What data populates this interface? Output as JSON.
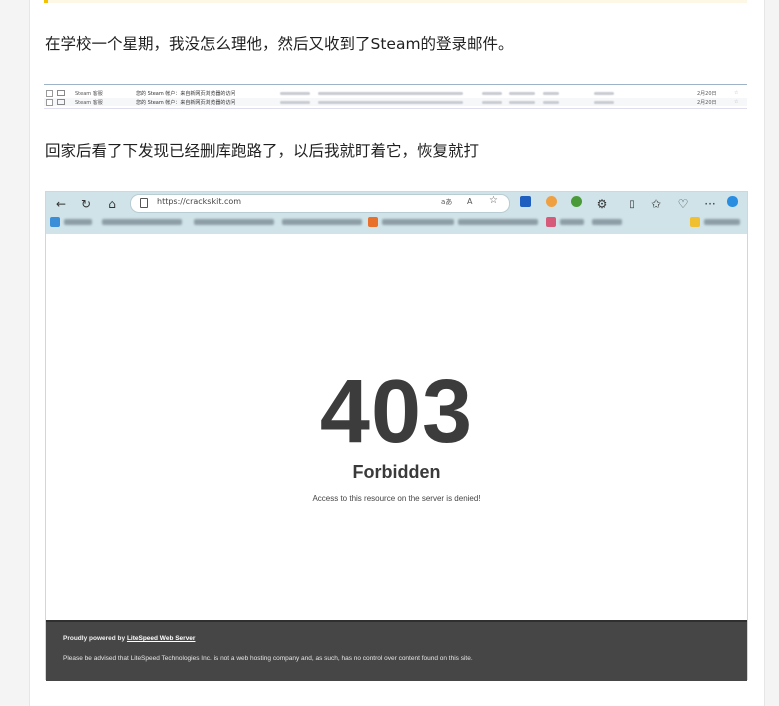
{
  "post": {
    "paragraph1": "在学校一个星期，我没怎么理他，然后又收到了Steam的登录邮件。",
    "paragraph2": "回家后看了下发现已经删库跑路了，以后我就盯着它，恢复就打"
  },
  "email_list": {
    "rows": [
      {
        "sender": "Steam 客服",
        "subject": "您的 Steam 帐户：来自新网页浏览器的访问",
        "date": "2月20日"
      },
      {
        "sender": "Steam 客服",
        "subject": "您的 Steam 帐户：来自新网页浏览器的访问",
        "date": "2月20日"
      }
    ]
  },
  "browser": {
    "url": "https://crackskit.com",
    "read_aloud_icon": "aあ",
    "text_icon": "A",
    "more_label": "···"
  },
  "error_page": {
    "code": "403",
    "title": "Forbidden",
    "message": "Access to this resource on the server is denied!",
    "footer_lead": "Proudly powered by",
    "footer_link": "LiteSpeed Web Server",
    "footer_note": "Please be advised that LiteSpeed Technologies Inc. is not a web hosting company and, as such, has no control over content found on this site."
  },
  "colors": {
    "chrome_bar": "#cfe3e8",
    "error_text": "#3c3c3c",
    "footer_bg": "#464646"
  }
}
